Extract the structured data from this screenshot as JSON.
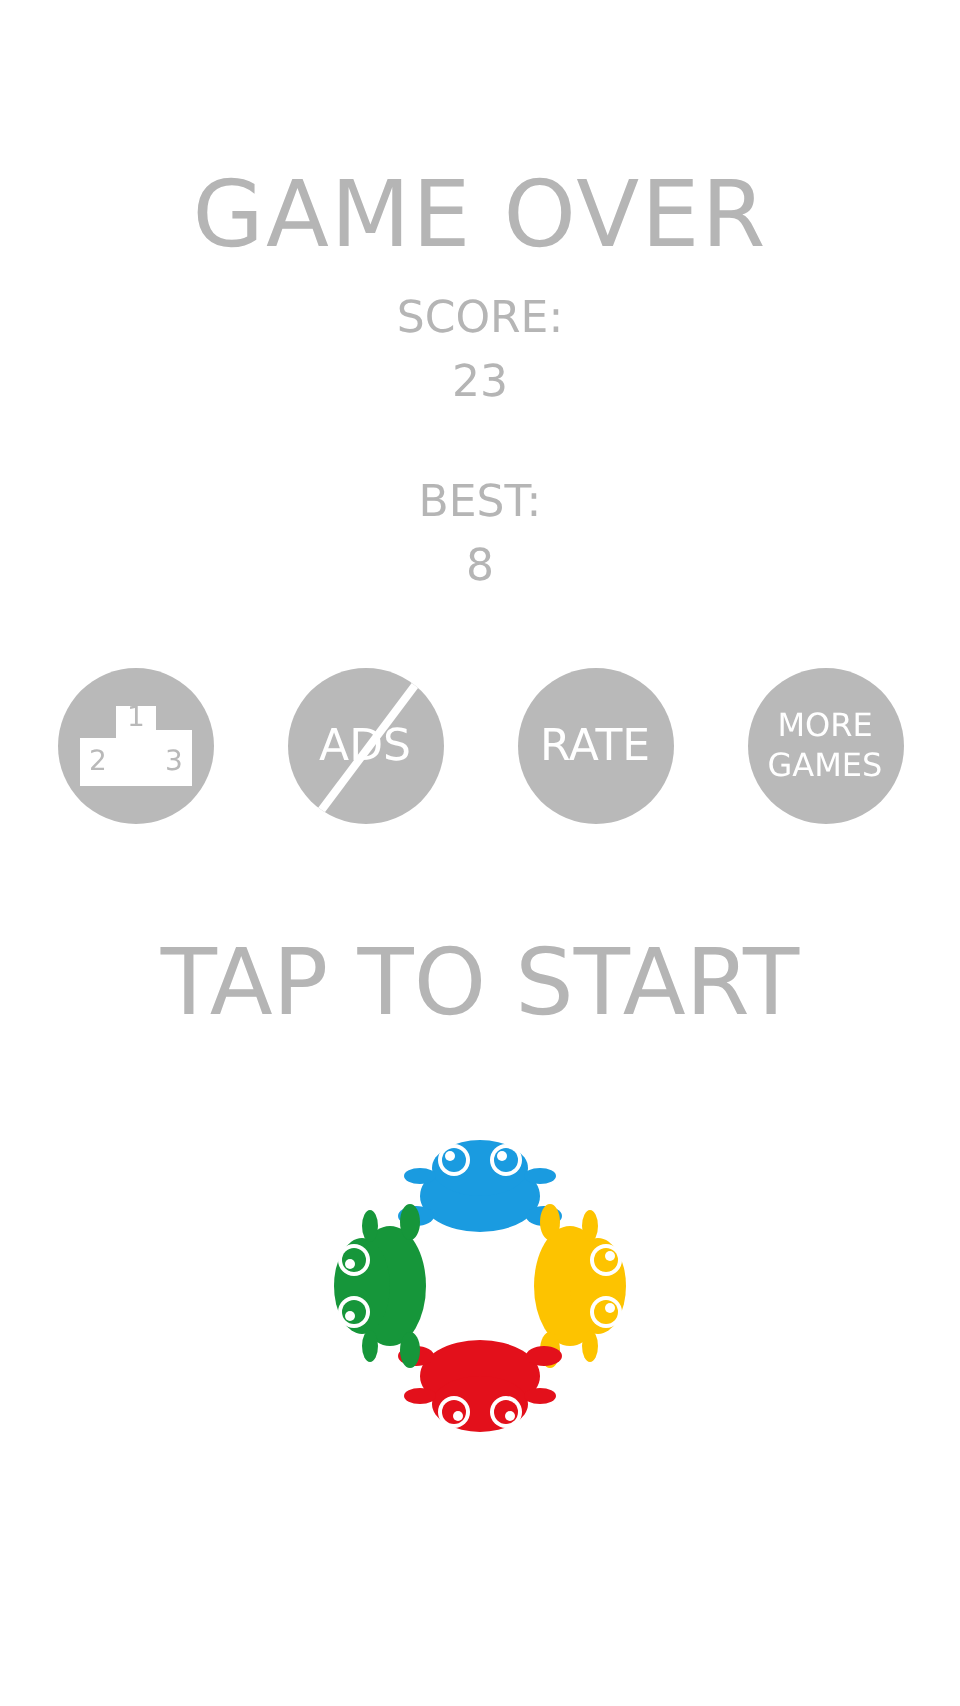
{
  "title": "GAME OVER",
  "score": {
    "label": "SCORE:",
    "value": "23"
  },
  "best": {
    "label": "BEST:",
    "value": "8"
  },
  "buttons": [
    {
      "kind": "podium",
      "digits": [
        "1",
        "2",
        "3"
      ]
    },
    {
      "kind": "ads",
      "label": "ADS"
    },
    {
      "kind": "rate",
      "label": "RATE"
    },
    {
      "kind": "more",
      "label": "MORE GAMES"
    }
  ],
  "prompt": "TAP TO START",
  "frogs": [
    {
      "color": "#1a9be0"
    },
    {
      "color": "#fdc300"
    },
    {
      "color": "#e3101b"
    },
    {
      "color": "#16963a"
    }
  ]
}
